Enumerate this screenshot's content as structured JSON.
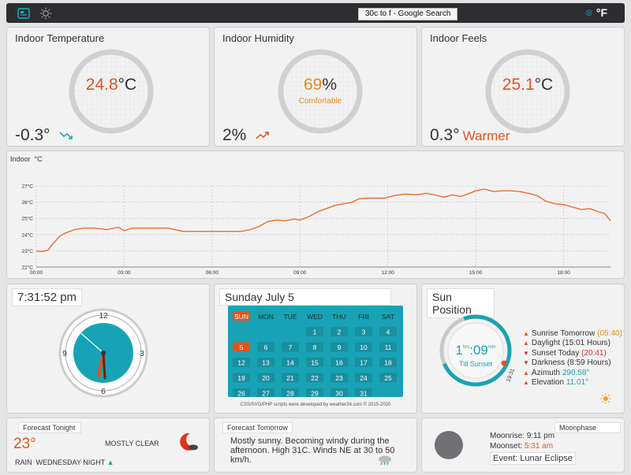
{
  "topbar": {
    "search_tip": "30c to f - Google Search",
    "unit_toggle": "°F",
    "icons": [
      "dashboard-icon",
      "settings-sun-icon"
    ]
  },
  "indoor_temperature": {
    "title": "Indoor Temperature",
    "value": "24.8",
    "unit": "°C",
    "trend": "-0.3°",
    "trend_icon": "trend-down-icon"
  },
  "indoor_humidity": {
    "title": "Indoor Humidity",
    "value": "69",
    "unit": "%",
    "status": "Comfortable",
    "trend": "2%",
    "trend_icon": "trend-up-icon"
  },
  "indoor_feels": {
    "title": "Indoor Feels",
    "value": "25.1",
    "unit": "°C",
    "trend": "0.3°",
    "trend_label": "Warmer"
  },
  "chart_data": {
    "type": "line",
    "title": "Indoor  °C",
    "xlabel": "",
    "ylabel": "",
    "x_ticks": [
      "00:00",
      "03:00",
      "06:00",
      "09:00",
      "12:00",
      "15:00",
      "18:00"
    ],
    "y_ticks": [
      "22°C",
      "23°C",
      "24°C",
      "25°C",
      "26°C",
      "27°C"
    ],
    "ylim": [
      22,
      27
    ],
    "xlim": [
      0,
      19.6
    ],
    "grid": true,
    "series": [
      {
        "name": "",
        "color": "#f26b2b",
        "x": [
          0,
          0.2,
          0.4,
          0.6,
          0.8,
          1.0,
          1.3,
          1.6,
          2.0,
          2.4,
          2.8,
          3.0,
          3.3,
          3.6,
          4.0,
          4.5,
          5.0,
          5.5,
          6.0,
          6.5,
          7.0,
          7.3,
          7.6,
          7.9,
          8.2,
          8.5,
          8.8,
          9.0,
          9.3,
          9.6,
          9.9,
          10.2,
          10.5,
          10.8,
          11.0,
          11.3,
          11.6,
          11.9,
          12.2,
          12.6,
          13.0,
          13.3,
          13.6,
          13.9,
          14.2,
          14.5,
          14.8,
          15.0,
          15.3,
          15.6,
          15.9,
          16.2,
          16.5,
          16.8,
          17.1,
          17.4,
          17.7,
          18.0,
          18.3,
          18.6,
          18.9,
          19.2,
          19.4,
          19.6
        ],
        "y": [
          23.0,
          22.95,
          23.05,
          23.5,
          23.9,
          24.1,
          24.3,
          24.4,
          24.4,
          24.3,
          24.45,
          24.25,
          24.4,
          24.4,
          24.4,
          24.4,
          24.2,
          24.2,
          24.2,
          24.2,
          24.2,
          24.3,
          24.5,
          24.8,
          24.9,
          24.85,
          24.95,
          24.9,
          25.1,
          25.4,
          25.6,
          25.8,
          25.9,
          26.0,
          26.2,
          26.25,
          26.25,
          26.25,
          26.4,
          26.5,
          26.45,
          26.55,
          26.45,
          26.3,
          26.45,
          26.35,
          26.55,
          26.7,
          26.8,
          26.65,
          26.7,
          26.7,
          26.65,
          26.55,
          26.4,
          26.05,
          25.9,
          25.85,
          25.7,
          25.55,
          25.6,
          25.4,
          25.3,
          24.85
        ]
      }
    ]
  },
  "clock": {
    "time": "7:31:52 pm",
    "dial_numbers": [
      "12",
      "3",
      "6",
      "9"
    ]
  },
  "calendar": {
    "title": "Sunday July 5",
    "headers": [
      "SUN",
      "MON",
      "TUE",
      "WED",
      "THU",
      "FRI",
      "SAT"
    ],
    "weeks": [
      [
        "",
        "",
        "",
        "1",
        "2",
        "3",
        "4"
      ],
      [
        "5",
        "6",
        "7",
        "8",
        "9",
        "10",
        "11"
      ],
      [
        "12",
        "13",
        "14",
        "15",
        "16",
        "17",
        "18"
      ],
      [
        "19",
        "20",
        "21",
        "22",
        "23",
        "24",
        "25"
      ],
      [
        "26",
        "27",
        "28",
        "29",
        "30",
        "31",
        ""
      ]
    ],
    "today": "5",
    "credit": "CSS/SVG/PHP scripts were developed by weather34.com © 2015-2020"
  },
  "sun_position": {
    "title": "Sun Position",
    "hours": "1",
    "hours_unit": "hrs",
    "minutes": "09",
    "minutes_unit": "min",
    "caption": "Till Sunset",
    "time_marker": "19:31",
    "sunrise_tomorrow_label": "Sunrise Tomorrow",
    "sunrise_tomorrow": "(05:40)",
    "daylight_label": "Daylight",
    "daylight": "(15:01 Hours)",
    "sunset_label": "Sunset Today",
    "sunset": "(20:41)",
    "darkness_label": "Darkness",
    "darkness": "(8:59 Hours)",
    "azimuth_label": "Azimuth",
    "azimuth": "290.58°",
    "elevation_label": "Elevation",
    "elevation": "11.01°"
  },
  "forecast_tonight": {
    "title": "Forecast Tonight",
    "temp": "23°",
    "condition": "MOSTLY CLEAR",
    "rain_label": "RAIN",
    "period": "WEDNESDAY NIGHT"
  },
  "forecast_tomorrow": {
    "title": "Forecast Tomorrow",
    "text": "Mostly sunny. Becoming windy during the afternoon. High 31C. Winds NE at 30 to 50 km/h."
  },
  "moonphase": {
    "title": "Moonphase",
    "moonrise_label": "Moonrise:",
    "moonrise": "9:11 pm",
    "moonset_label": "Moonset:",
    "moonset": "5:31 am",
    "event": "Event: Lunar Eclipse"
  }
}
